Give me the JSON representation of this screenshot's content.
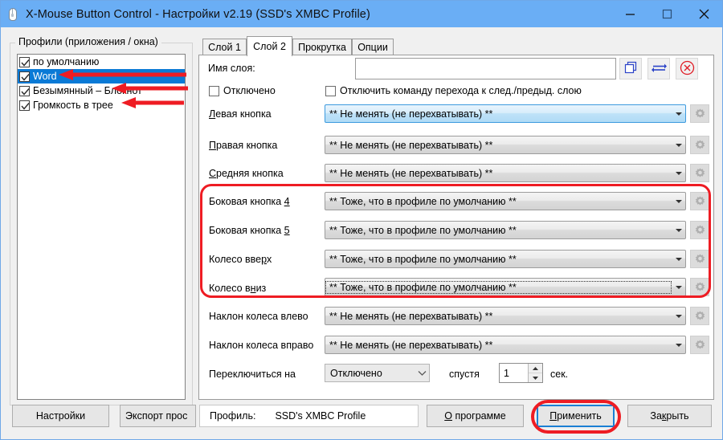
{
  "window": {
    "title": "X-Mouse Button Control - Настройки v2.19 (SSD's XMBC Profile)",
    "minimize_label": "—",
    "maximize_label": "□",
    "close_label": "✕"
  },
  "profiles_group": {
    "title": "Профили (приложения / окна)",
    "items": [
      {
        "label": "по умолчанию",
        "checked": true,
        "selected": false
      },
      {
        "label": "Word",
        "checked": true,
        "selected": true
      },
      {
        "label": "Безымянный – Блокнот",
        "checked": true,
        "selected": false
      },
      {
        "label": "Громкость в трее",
        "checked": true,
        "selected": false
      }
    ]
  },
  "tabs": [
    {
      "label": "Слой 1",
      "active": false
    },
    {
      "label": "Слой 2",
      "active": true
    },
    {
      "label": "Прокрутка",
      "active": false
    },
    {
      "label": "Опции",
      "active": false
    }
  ],
  "layer": {
    "name_label": "Имя слоя:",
    "name_value": "",
    "copy_icon": "copy-layer-icon",
    "swap_icon": "swap-layers-icon",
    "clear_icon": "clear-layer-icon",
    "disabled_checkbox_label": "Отключено",
    "disabled_checkbox_checked": false,
    "disable_nav_checkbox_label": "Отключить команду перехода к след./предыд. слою",
    "disable_nav_checkbox_checked": false
  },
  "no_change_value": "** Не менять (не перехватывать) **",
  "same_as_default_value": "** Тоже, что в профиле по умолчанию **",
  "button_rows": [
    {
      "label": "Левая кнопка",
      "mnemonic": "Л",
      "value": "** Не менять (не перехватывать) **",
      "state": "focus"
    },
    {
      "label": "Правая кнопка",
      "mnemonic": "П",
      "value": "** Не менять (не перехватывать) **",
      "state": "normal"
    },
    {
      "label": "Средняя кнопка",
      "mnemonic": "С",
      "value": "** Не менять (не перехватывать) **",
      "state": "normal"
    },
    {
      "label": "Боковая кнопка 4",
      "mnemonic": "4",
      "value": "** Тоже, что в профиле по умолчанию **",
      "state": "normal"
    },
    {
      "label": "Боковая кнопка 5",
      "mnemonic": "5",
      "value": "** Тоже, что в профиле по умолчанию **",
      "state": "normal"
    },
    {
      "label": "Колесо вверх",
      "mnemonic": "р",
      "value": "** Тоже, что в профиле по умолчанию **",
      "state": "normal"
    },
    {
      "label": "Колесо вниз",
      "mnemonic": "н",
      "value": "** Тоже, что в профиле по умолчанию **",
      "state": "dotted"
    },
    {
      "label": "Наклон колеса влево",
      "mnemonic": "",
      "value": "** Не менять (не перехватывать) **",
      "state": "normal"
    },
    {
      "label": "Наклон колеса вправо",
      "mnemonic": "",
      "value": "** Не менять (не перехватывать) **",
      "state": "normal"
    }
  ],
  "switch_row": {
    "label": "Переключиться на",
    "target_value": "Отключено",
    "after_label": "спустя",
    "seconds_value": "1",
    "seconds_unit": "сек."
  },
  "bottom_bar": {
    "settings_button": "Настройки",
    "export_button": "Экспорт проc",
    "profile_label": "Профиль:",
    "profile_value": "SSD's XMBC Profile",
    "about_button": "О программе",
    "apply_button": "Применить",
    "close_button": "Закрыть"
  },
  "annotations": {
    "highlight_color": "#ee1c23",
    "arrow_count": 3,
    "box_target": "side-button-and-wheel-rows",
    "ellipse_target": "apply-button"
  }
}
